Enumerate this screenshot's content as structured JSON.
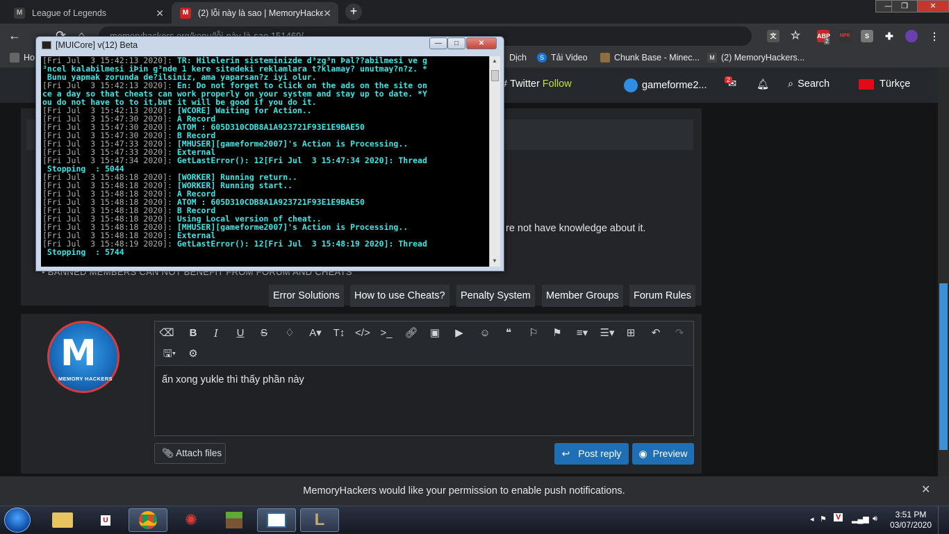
{
  "browser": {
    "tabs": [
      {
        "title": "League of Legends",
        "favicon": "M"
      },
      {
        "title": "(2) lỗi này là sao | MemoryHacker",
        "favicon": "M"
      }
    ],
    "url": "memoryhackers.org/konu/lỗi-này-là-sao.151469/",
    "bookmarks": [
      {
        "label": "Ho"
      },
      {
        "label": "Dịch"
      },
      {
        "label": "Tải Video"
      },
      {
        "label": "Chunk Base - Minec..."
      },
      {
        "label": "(2) MemoryHackers..."
      }
    ],
    "ext_badge": "2"
  },
  "site": {
    "nav": {
      "twitter": "Twitter",
      "follow": "Follow",
      "username": "gameforme2...",
      "inbox_badge": "2",
      "search": "Search",
      "language": "Türkçe"
    },
    "notice_tail": "re not have knowledge about it.",
    "banned_notice": "BANNED MEMBERS CAN NOT BENEFIT FROM FORUM AND CHEATS",
    "rule_buttons": [
      "Error Solutions",
      "How to use Cheats?",
      "Penalty System",
      "Member Groups",
      "Forum Rules"
    ],
    "avatar_label": "MEMORY HACKERS",
    "editor_text": "ấn xong yukle thì thấy phần này",
    "attach_label": "Attach files",
    "post_reply_label": "Post reply",
    "preview_label": "Preview",
    "push_notice": "MemoryHackers would like your permission to enable push notifications."
  },
  "console": {
    "title": "[MUICore] v(12) Beta",
    "lines": [
      {
        "ts": "[Fri Jul  3 15:42:13 2020]: ",
        "msg": "TR: Hilelerin sisteminizde d³zg³n Þal??abilmesi ve g"
      },
      {
        "ts": "",
        "msg": "³ncel kalabilmesi iÞin g³nde 1 kere sitedeki reklamlara t?klamay? unutmay?n?z. *"
      },
      {
        "ts": "",
        "msg": " Bunu yapmak zorunda de?ilsiniz, ama yaparsan?z iyi olur."
      },
      {
        "ts": "[Fri Jul  3 15:42:13 2020]: ",
        "msg": "En: Do not forget to click on the ads on the site on"
      },
      {
        "ts": "",
        "msg": "ce a day so that cheats can work properly on your system and stay up to date. *Y"
      },
      {
        "ts": "",
        "msg": "ou do not have to to it,but it will be good if you do it."
      },
      {
        "ts": "[Fri Jul  3 15:42:13 2020]: ",
        "msg": "[WCORE] Waiting for Action.."
      },
      {
        "ts": "[Fri Jul  3 15:47:30 2020]: ",
        "msg": "A Record"
      },
      {
        "ts": "[Fri Jul  3 15:47:30 2020]: ",
        "msg": "ATOM : 605D310CDB8A1A923721F93E1E9BAE50"
      },
      {
        "ts": "[Fri Jul  3 15:47:30 2020]: ",
        "msg": "B Record"
      },
      {
        "ts": "[Fri Jul  3 15:47:33 2020]: ",
        "msg": "[MHUSER][gameforme2007]'s Action is Processing.."
      },
      {
        "ts": "[Fri Jul  3 15:47:33 2020]: ",
        "msg": "External"
      },
      {
        "ts": "[Fri Jul  3 15:47:34 2020]: ",
        "msg": "GetLastError(): 12[Fri Jul  3 15:47:34 2020]: Thread"
      },
      {
        "ts": "",
        "msg": " Stopping  : 5044"
      },
      {
        "ts": "[Fri Jul  3 15:48:18 2020]: ",
        "msg": "[WORKER] Running return.."
      },
      {
        "ts": "[Fri Jul  3 15:48:18 2020]: ",
        "msg": "[WORKER] Running start.."
      },
      {
        "ts": "[Fri Jul  3 15:48:18 2020]: ",
        "msg": "A Record"
      },
      {
        "ts": "[Fri Jul  3 15:48:18 2020]: ",
        "msg": "ATOM : 605D310CDB8A1A923721F93E1E9BAE50"
      },
      {
        "ts": "[Fri Jul  3 15:48:18 2020]: ",
        "msg": "B Record"
      },
      {
        "ts": "[Fri Jul  3 15:48:18 2020]: ",
        "msg": "Using Local version of cheat.."
      },
      {
        "ts": "[Fri Jul  3 15:48:18 2020]: ",
        "msg": "[MHUSER][gameforme2007]'s Action is Processing.."
      },
      {
        "ts": "[Fri Jul  3 15:48:18 2020]: ",
        "msg": "External"
      },
      {
        "ts": "[Fri Jul  3 15:48:19 2020]: ",
        "msg": "GetLastError(): 12[Fri Jul  3 15:48:19 2020]: Thread"
      },
      {
        "ts": "",
        "msg": " Stopping  : 5744"
      }
    ]
  },
  "taskbar": {
    "time": "3:51 PM",
    "date": "03/07/2020"
  }
}
